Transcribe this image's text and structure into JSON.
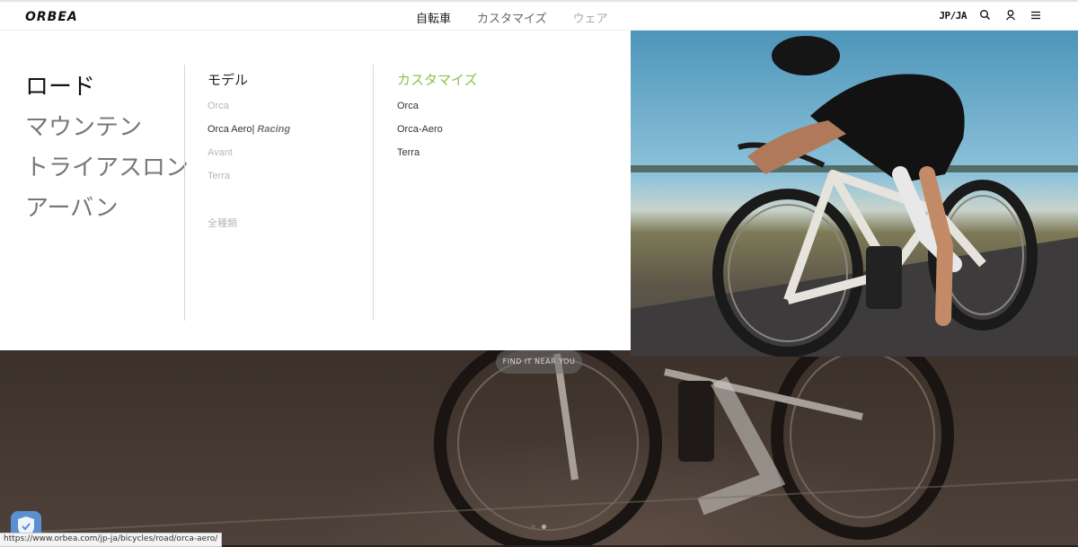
{
  "header": {
    "logo": "ORBEA",
    "nav": [
      "自転車",
      "カスタマイズ",
      "ウェア"
    ],
    "lang": "JP/JA",
    "icons": [
      "search-icon",
      "user-icon",
      "menu-icon"
    ]
  },
  "menu": {
    "categories": [
      "ロード",
      "マウンテン",
      "トライアスロン",
      "アーバン"
    ],
    "models_heading": "モデル",
    "models": {
      "orca": "Orca",
      "orca_aero": "Orca Aero|",
      "racing": "Racing",
      "avant": "Avant",
      "terra": "Terra",
      "all": "全種類"
    },
    "custom_heading": "カスタマイズ",
    "custom_items": [
      "Orca",
      "Orca-Aero",
      "Terra"
    ],
    "accent_color": "#8bc34a"
  },
  "hero": {
    "find_button": "FIND IT NEAR YOU"
  },
  "status_url": "https://www.orbea.com/jp-ja/bicycles/road/orca-aero/"
}
